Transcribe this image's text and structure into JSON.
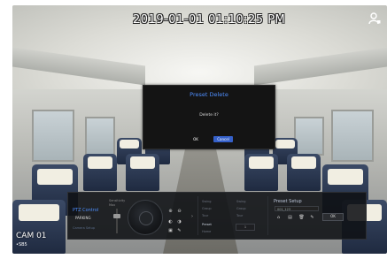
{
  "overlay": {
    "timestamp": "2019-01-01 01:10:25 PM",
    "camera_label": "CAM 01",
    "status_tag": "•SB5"
  },
  "dialog": {
    "title": "Preset Delete",
    "message": "Delete it?",
    "ok_label": "OK",
    "cancel_label": "Cancel"
  },
  "ptz": {
    "title": "PTZ Control",
    "mode": "PARKING",
    "setup_link": "Camera Setup",
    "sensitivity_label": "Sensitivity",
    "sensitivity_value": "Max",
    "options_left": [
      "Swing",
      "Group",
      "Tour",
      "Trace"
    ],
    "options_mid": [
      "Preset",
      "Home"
    ],
    "options_right": [
      "Swing",
      "Group",
      "Tour",
      "Trace"
    ],
    "preset_selected": "Preset",
    "preset_number": "1",
    "preset_setup_title": "Preset Setup",
    "preset_name": "001_123",
    "preset_ok_label": "OK"
  },
  "icons": [
    "person-icon",
    "zoom-in-icon",
    "zoom-out-icon",
    "focus-icon",
    "iris-icon",
    "save-icon",
    "edit-icon",
    "delete-icon",
    "home-icon",
    "arrow-right-icon"
  ],
  "colors": {
    "accent": "#4f8fff",
    "cancel_button": "#3560c9",
    "panel_bg": "#0f1114"
  }
}
